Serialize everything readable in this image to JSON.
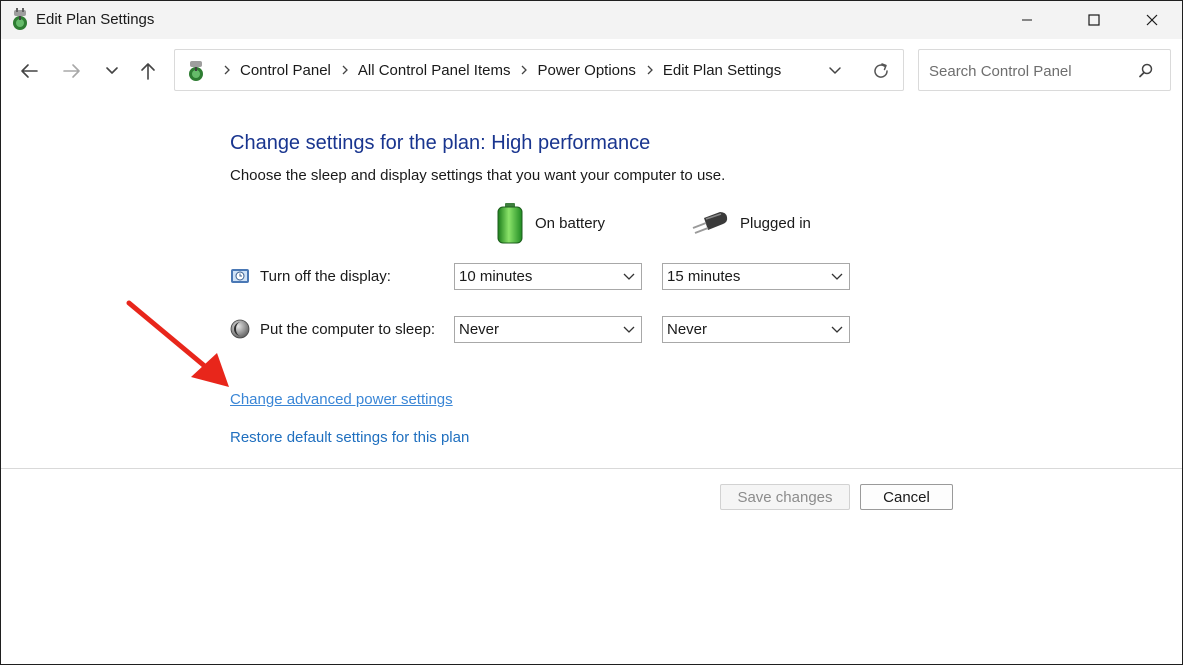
{
  "window": {
    "title": "Edit Plan Settings",
    "minimize_glyph": "minimize-icon",
    "maximize_glyph": "maximize-icon",
    "close_glyph": "close-icon"
  },
  "address": {
    "breadcrumbs": [
      "Control Panel",
      "All Control Panel Items",
      "Power Options",
      "Edit Plan Settings"
    ]
  },
  "search": {
    "placeholder": "Search Control Panel"
  },
  "content": {
    "heading": "Change settings for the plan: High performance",
    "description": "Choose the sleep and display settings that you want your computer to use.",
    "columns": {
      "battery": "On battery",
      "plugged": "Plugged in"
    },
    "rows": [
      {
        "label": "Turn off the display:",
        "battery": "10 minutes",
        "plugged": "15 minutes",
        "icon": "display-icon"
      },
      {
        "label": "Put the computer to sleep:",
        "battery": "Never",
        "plugged": "Never",
        "icon": "sleep-moon-icon"
      }
    ],
    "links": {
      "advanced": "Change advanced power settings",
      "restore": "Restore default settings for this plan"
    }
  },
  "buttons": {
    "save": "Save changes",
    "cancel": "Cancel"
  },
  "colors": {
    "heading": "#19358f",
    "link": "#1f6fbf",
    "annotation_arrow": "#e8261b"
  }
}
